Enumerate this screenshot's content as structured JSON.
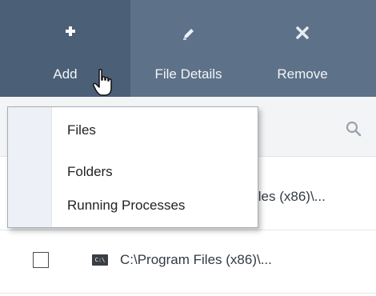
{
  "toolbar": {
    "add_label": "Add",
    "file_details_label": "File Details",
    "remove_label": "Remove"
  },
  "dropdown": {
    "items": [
      "Files",
      "Folders",
      "Running Processes"
    ]
  },
  "rows": [
    {
      "path": "iles (x86)\\..."
    },
    {
      "path": "C:\\Program Files (x86)\\..."
    }
  ],
  "colors": {
    "toolbar": "#5d7188",
    "toolbar_active": "#4b5f77",
    "menu_gutter": "#edf1f7"
  }
}
